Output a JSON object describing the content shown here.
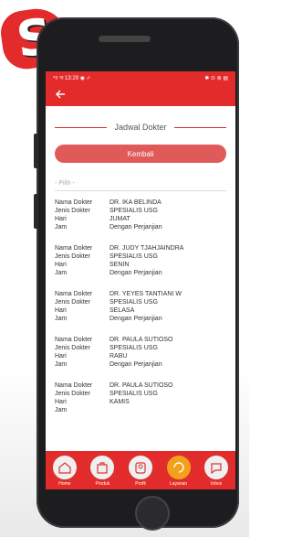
{
  "brand": {
    "badge_letter": "S",
    "accent": "#e32b2b"
  },
  "status_bar": {
    "left": "⁴ᵍ ⁴ᵍ 13:29 ◉ ✓",
    "right": "✱ ⊙ ⊕ ▤"
  },
  "app_bar": {
    "back_icon": "arrow-left-icon"
  },
  "page": {
    "title": "Jadwal Dokter",
    "back_button": "Kembali",
    "select_placeholder": "- Pilih -"
  },
  "labels": {
    "nama": "Nama Dokter",
    "jenis": "Jenis Dokter",
    "hari": "Hari",
    "jam": "Jam"
  },
  "schedule": [
    {
      "nama": "DR. IKA BELINDA",
      "jenis": "SPESIALIS USG",
      "hari": "JUMAT",
      "jam": "Dengan Perjanjian"
    },
    {
      "nama": "DR. JUDY TJAHJAINDRA",
      "jenis": "SPESIALIS USG",
      "hari": "SENIN",
      "jam": "Dengan Perjanjian"
    },
    {
      "nama": "DR. YEYES TANTIANI W",
      "jenis": "SPESIALIS USG",
      "hari": "SELASA",
      "jam": "Dengan Perjanjian"
    },
    {
      "nama": "DR. PAULA SUTIOSO",
      "jenis": "SPESIALIS USG",
      "hari": "RABU",
      "jam": "Dengan Perjanjian"
    },
    {
      "nama": "DR. PAULA SUTIOSO",
      "jenis": "SPESIALIS USG",
      "hari": "KAMIS",
      "jam": ""
    }
  ],
  "bottom_nav": [
    {
      "label": "Home",
      "icon": "home-icon"
    },
    {
      "label": "Produk",
      "icon": "bag-icon"
    },
    {
      "label": "Profil",
      "icon": "profile-icon"
    },
    {
      "label": "Layanan",
      "icon": "service-icon",
      "active": true
    },
    {
      "label": "Inbox",
      "icon": "chat-icon"
    }
  ]
}
